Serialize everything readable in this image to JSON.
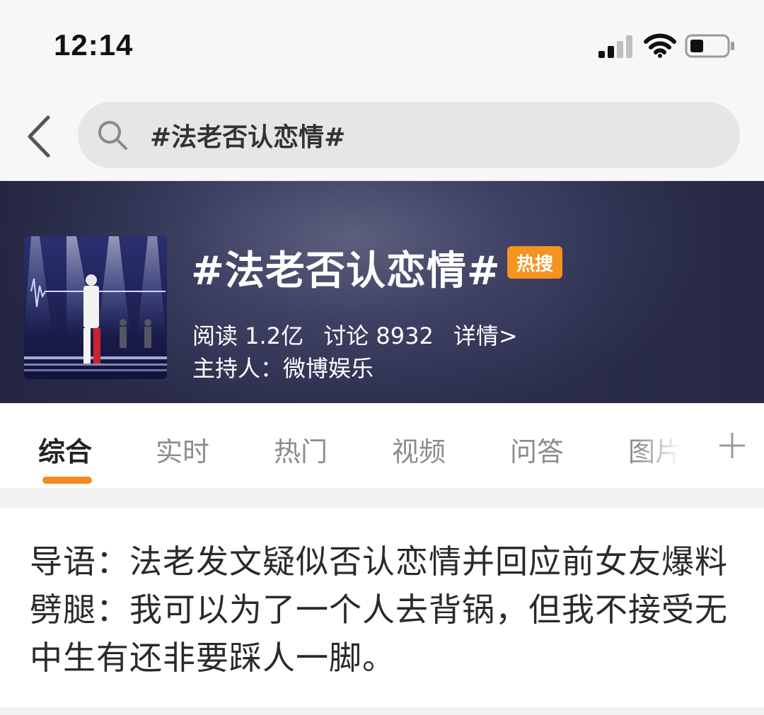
{
  "status_bar": {
    "time": "12:14"
  },
  "search": {
    "query": "#法老否认恋情#"
  },
  "topic": {
    "title": "#法老否认恋情#",
    "badge": "热搜",
    "reads": "阅读 1.2亿",
    "discussions": "讨论 8932",
    "details_link": "详情>",
    "host": "主持人：微博娱乐"
  },
  "tabs": [
    {
      "label": "综合",
      "active": true
    },
    {
      "label": "实时",
      "active": false
    },
    {
      "label": "热门",
      "active": false
    },
    {
      "label": "视频",
      "active": false
    },
    {
      "label": "问答",
      "active": false
    },
    {
      "label": "图片",
      "active": false
    }
  ],
  "intro": {
    "text": "导语：法老发文疑似否认恋情并回应前女友爆料劈腿：我可以为了一个人去背锅，但我不接受无中生有还非要踩人一脚。"
  },
  "colors": {
    "accent_orange": "#f28a1c",
    "badge_orange": "#f5931f",
    "banner_bg": "#3e4163"
  }
}
